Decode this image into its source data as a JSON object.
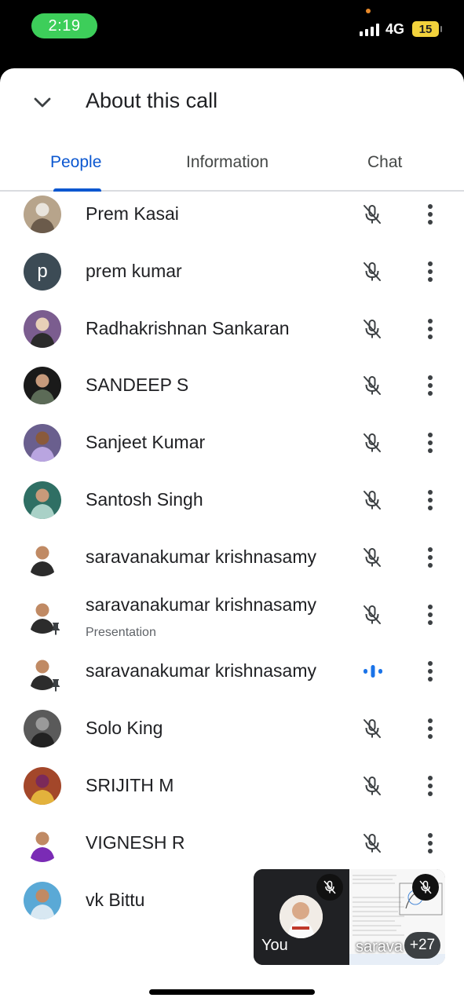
{
  "status_bar": {
    "time": "2:19",
    "network": "4G",
    "battery": "15"
  },
  "header": {
    "title": "About this call"
  },
  "tabs": [
    {
      "label": "People",
      "active": true
    },
    {
      "label": "Information",
      "active": false
    },
    {
      "label": "Chat",
      "active": false
    }
  ],
  "participants": [
    {
      "name": "Prem Kasai",
      "avatar": "photo",
      "mic": "muted"
    },
    {
      "name": "prem kumar",
      "avatar": "letter",
      "initial": "p",
      "mic": "muted"
    },
    {
      "name": "Radhakrishnan Sankaran",
      "avatar": "photo",
      "mic": "muted"
    },
    {
      "name": "SANDEEP S",
      "avatar": "photo",
      "mic": "muted"
    },
    {
      "name": "Sanjeet Kumar",
      "avatar": "photo",
      "mic": "muted"
    },
    {
      "name": "Santosh Singh",
      "avatar": "photo",
      "mic": "muted"
    },
    {
      "name": "saravanakumar krishnasamy",
      "avatar": "photo",
      "mic": "muted"
    },
    {
      "name": "saravanakumar krishnasamy",
      "subtitle": "Presentation",
      "avatar": "photo",
      "pinned": true,
      "mic": "muted"
    },
    {
      "name": "saravanakumar krishnasamy",
      "avatar": "photo",
      "pinned": true,
      "mic": "speaking"
    },
    {
      "name": "Solo King",
      "avatar": "photo",
      "mic": "muted"
    },
    {
      "name": "SRIJITH M",
      "avatar": "photo",
      "mic": "muted"
    },
    {
      "name": "VIGNESH R",
      "avatar": "photo",
      "mic": "muted"
    },
    {
      "name": "vk Bittu",
      "avatar": "photo",
      "mic": "none"
    }
  ],
  "pip": {
    "self_label": "You",
    "presenter_label": "sarava",
    "more_count": "+27"
  },
  "colors": {
    "accent": "#0b57d0",
    "status_green": "#3dce5a",
    "battery_yellow": "#f2d23c",
    "speaking_blue": "#1a73e8"
  },
  "icons": {
    "back": "chevron-down-icon",
    "mic_muted": "mic-off-icon",
    "speaking": "audio-wave-icon",
    "more": "more-vert-icon",
    "pinned": "pin-icon"
  }
}
